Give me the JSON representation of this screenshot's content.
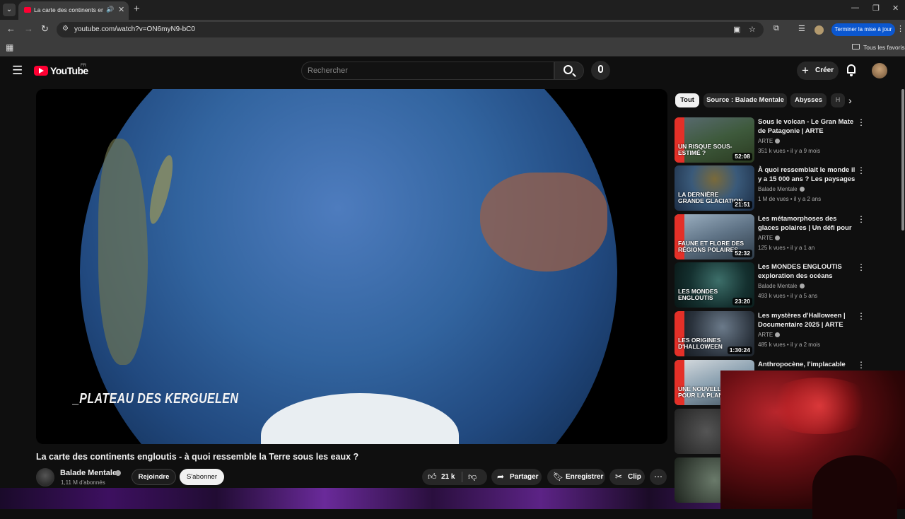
{
  "browser": {
    "tab_title": "La carte des continents englo",
    "url": "youtube.com/watch?v=ON6myN9-bC0",
    "update_button": "Terminer la mise à jour",
    "bookmarks_label": "Tous les favoris"
  },
  "header": {
    "logo": "YouTube",
    "country": "FR",
    "search_placeholder": "Rechercher",
    "create_label": "Créer"
  },
  "player": {
    "caption": "_PLATEAU DES KERGUELEN"
  },
  "video": {
    "title": "La carte des continents engloutis - à quoi ressemble la Terre sous les eaux ?",
    "channel": "Balade Mentale",
    "subscribers": "1,11 M d'abonnés",
    "join_label": "Rejoindre",
    "subscribe_label": "S'abonner",
    "likes": "21 k",
    "share_label": "Partager",
    "save_label": "Enregistrer",
    "clip_label": "Clip"
  },
  "chips": [
    "Tout",
    "Source : Balade Mentale",
    "Abysses",
    "H"
  ],
  "recommendations": [
    {
      "title": "Sous le volcan - Le Gran Mate de Patagonie | ARTE",
      "channel": "ARTE",
      "meta": "351 k vues • il y a 9 mois",
      "duration": "52:08",
      "overlay": "UN RISQUE SOUS-ESTIMÉ ?",
      "arte": true,
      "bg": "linear-gradient(160deg, #5a6b73 0%, #3e5a3c 50%, #2a3a20 100%)"
    },
    {
      "title": "À quoi ressemblait le monde il y a 15 000 ans ? Les paysages ...",
      "channel": "Balade Mentale",
      "meta": "1 M de vues • il y a 2 ans",
      "duration": "21:51",
      "overlay": "LA DERNIÈRE GRANDE GLACIATION",
      "arte": false,
      "bg": "radial-gradient(circle at 50% 30%, #7a6a3a 0%, #3a5a7a 45%, #1c2d45 100%)"
    },
    {
      "title": "Les métamorphoses des glaces polaires | Un défi pour les ...",
      "channel": "ARTE",
      "meta": "125 k vues • il y a 1 an",
      "duration": "52:32",
      "overlay": "FAUNE ET FLORE DES RÉGIONS POLAIRES",
      "arte": true,
      "bg": "linear-gradient(160deg, #9fb3c4 0%, #5f7386 50%, #2d3a46 100%)"
    },
    {
      "title": "Les MONDES ENGLOUTIS exploration des océans",
      "channel": "Balade Mentale",
      "meta": "493 k vues • il y a 5 ans",
      "duration": "23:20",
      "overlay": "LES MONDES ENGLOUTIS",
      "arte": false,
      "bg": "radial-gradient(circle at 55% 40%, #3d6f6a 0%, #14302f 55%, #081615 100%)"
    },
    {
      "title": "Les mystères d'Halloween | Documentaire 2025 | ARTE",
      "channel": "ARTE",
      "meta": "485 k vues • il y a 2 mois",
      "duration": "1:30:24",
      "overlay": "LES ORIGINES D'HALLOWEEN",
      "arte": true,
      "bg": "radial-gradient(circle at 60% 35%, #6b7a8a 0%, #2a323c 55%, #101418 100%)"
    },
    {
      "title": "Anthropocène, l'implacable",
      "channel": "",
      "meta": "",
      "duration": "",
      "overlay": "UNE NOUVELLE ÈRE POUR LA PLANÈTE",
      "arte": true,
      "bg": "linear-gradient(160deg, #d9dde0 0%, #8aa0b0 50%, #3d4c58 100%)"
    }
  ]
}
